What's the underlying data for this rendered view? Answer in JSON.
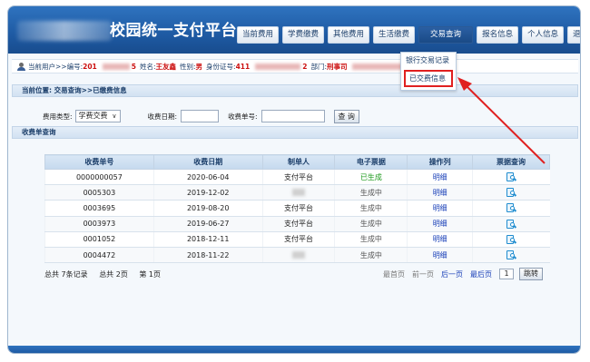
{
  "app": {
    "title": "校园统一支付平台"
  },
  "nav": {
    "items": [
      "当前费用",
      "学费缴费",
      "其他费用",
      "生活缴费",
      "交易查询",
      "报名信息",
      "个人信息",
      "退出登录"
    ],
    "active_index": 4,
    "dropdown": [
      "银行交易记录",
      "已交费信息"
    ],
    "dropdown_selected_index": 1
  },
  "user": {
    "current_user_label": "当前用户>>编号:",
    "id_partial": "201",
    "id_tail": "5",
    "name_label": "姓名:",
    "name": "王友鑫",
    "gender_label": "性别:",
    "gender": "男",
    "idcard_label": "身份证号:",
    "idcard_partial": "411",
    "idcard_tail": "2",
    "dept_label": "部门:",
    "dept_partial": "刑事司"
  },
  "breadcrumb": "当前位置: 交易查询>>已缴费信息",
  "filters": {
    "fee_type_label": "费用类型:",
    "fee_type_value": "学费交费",
    "date_label": "收费日期:",
    "receipt_label": "收费单号:",
    "search_button": "查 询"
  },
  "section_title": "收费单查询",
  "table": {
    "headers": [
      "收费单号",
      "收费日期",
      "制单人",
      "电子票据",
      "操作列",
      "票据查询"
    ],
    "rows": [
      {
        "no": "0000000057",
        "date": "2020-06-04",
        "maker": "支付平台",
        "status": "已生成",
        "action": "明细"
      },
      {
        "no": "0005303",
        "date": "2019-12-02",
        "maker": "",
        "status": "生成中",
        "action": "明细"
      },
      {
        "no": "0003695",
        "date": "2019-08-20",
        "maker": "支付平台",
        "status": "生成中",
        "action": "明细"
      },
      {
        "no": "0003973",
        "date": "2019-06-27",
        "maker": "支付平台",
        "status": "生成中",
        "action": "明细"
      },
      {
        "no": "0001052",
        "date": "2018-12-11",
        "maker": "支付平台",
        "status": "生成中",
        "action": "明细"
      },
      {
        "no": "0004472",
        "date": "2018-11-22",
        "maker": "",
        "status": "生成中",
        "action": "明细"
      }
    ]
  },
  "pager": {
    "total_records": "总共  7条记录",
    "total_pages": "总共  2页",
    "current_page": "第 1页",
    "first": "最首页",
    "prev": "前一页",
    "next": "后一页",
    "last": "最后页",
    "page_value": "1",
    "jump": "跳转"
  },
  "colors": {
    "header": "#1e5aa3",
    "highlight": "#e02020",
    "generated": "#1d9a1d",
    "link": "#1a40b8"
  }
}
